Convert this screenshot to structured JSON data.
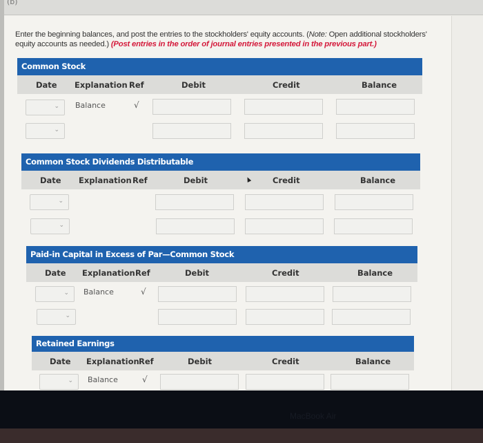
{
  "part_label": "(b)",
  "instructions": {
    "main": "Enter the beginning balances, and post the entries to the stockholders' equity accounts. (",
    "note_label": "Note:",
    "note_text": " Open additional stockholders' equity accounts as needed.) ",
    "red": "(Post entries in the order of journal entries presented in the previous part.)"
  },
  "columns": {
    "date": "Date",
    "explanation": "Explanation",
    "ref": "Ref",
    "debit": "Debit",
    "credit": "Credit",
    "balance": "Balance"
  },
  "ledgers": [
    {
      "title": "Common Stock",
      "rows": [
        {
          "date": "",
          "explanation": "Balance",
          "ref": "√",
          "debit": "",
          "credit": "",
          "balance": ""
        },
        {
          "date": "",
          "explanation": "",
          "ref": "",
          "debit": "",
          "credit": "",
          "balance": ""
        }
      ]
    },
    {
      "title": "Common Stock Dividends Distributable",
      "rows": [
        {
          "date": "",
          "explanation": "",
          "ref": "",
          "debit": "",
          "credit": "",
          "balance": ""
        },
        {
          "date": "",
          "explanation": "",
          "ref": "",
          "debit": "",
          "credit": "",
          "balance": ""
        }
      ]
    },
    {
      "title": "Paid-in Capital in Excess of Par—Common Stock",
      "rows": [
        {
          "date": "",
          "explanation": "Balance",
          "ref": "√",
          "debit": "",
          "credit": "",
          "balance": ""
        },
        {
          "date": "",
          "explanation": "",
          "ref": "",
          "debit": "",
          "credit": "",
          "balance": ""
        }
      ]
    },
    {
      "title": "Retained Earnings",
      "rows": [
        {
          "date": "",
          "explanation": "Balance",
          "ref": "√",
          "debit": "",
          "credit": "",
          "balance": ""
        }
      ]
    }
  ],
  "icons": {
    "chevron": "⌄"
  },
  "bezel_label": "MacBook Air",
  "colors": {
    "header_blue": "#1f62ae",
    "column_header_gray": "#dcdcd9",
    "instruction_red": "#d4183a"
  }
}
